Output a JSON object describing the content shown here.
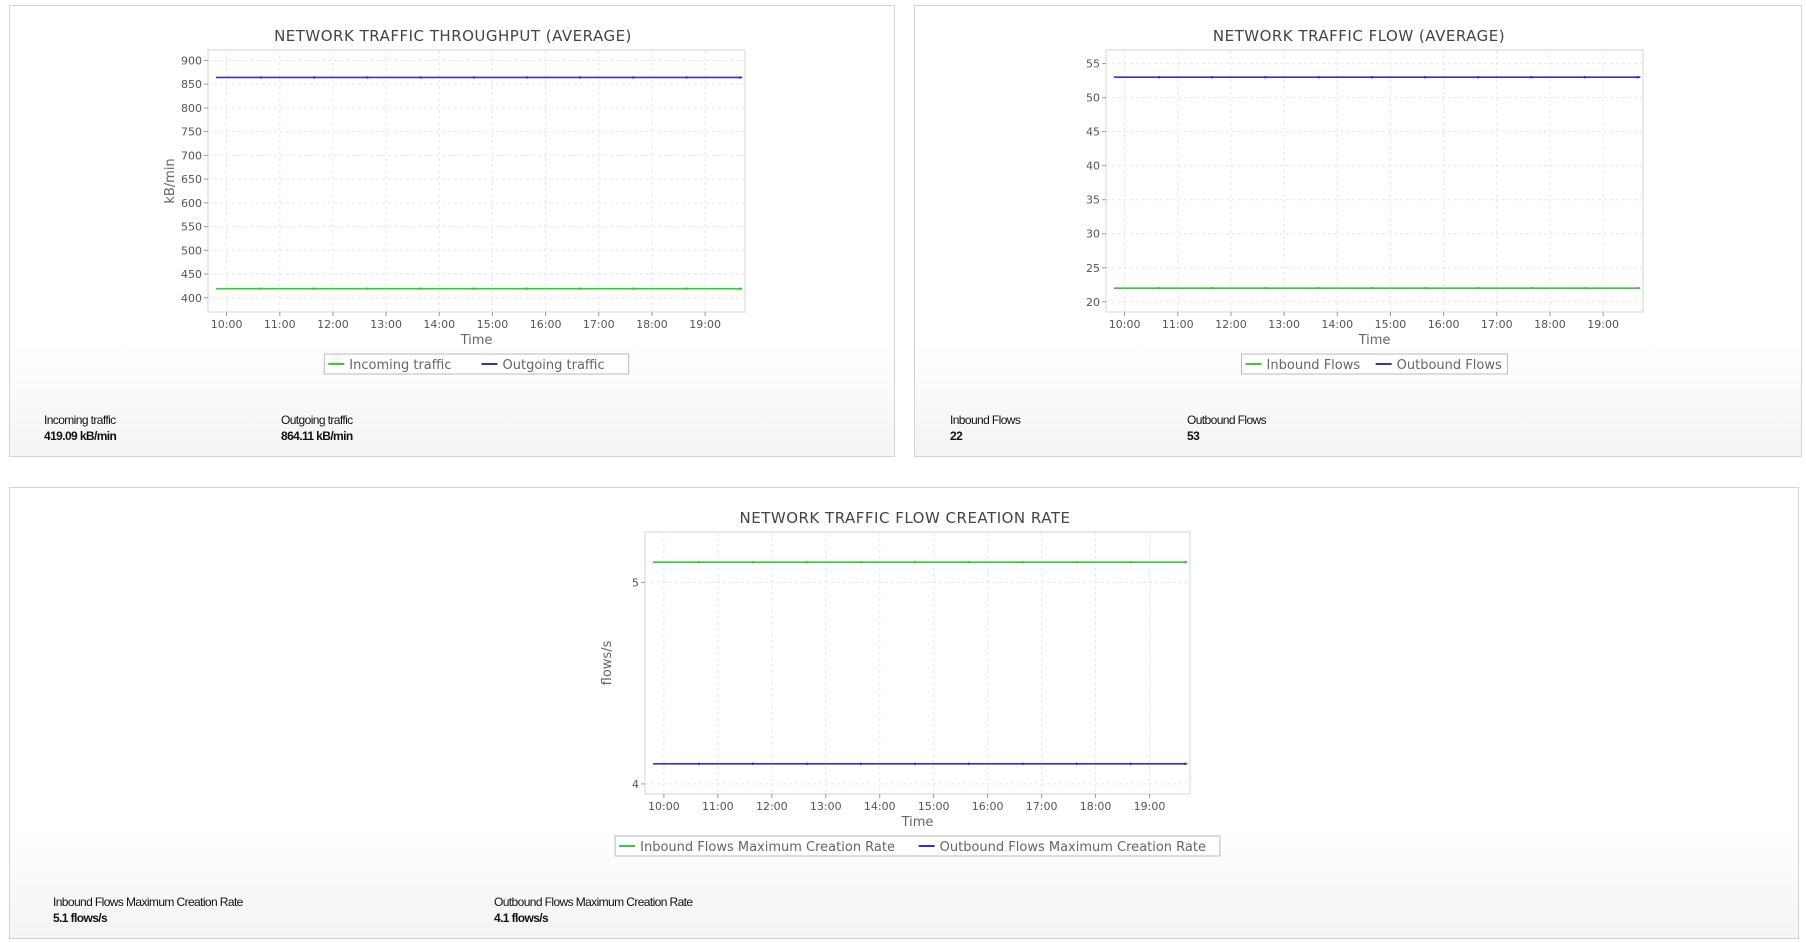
{
  "chart_data": [
    {
      "type": "line",
      "title": "NETWORK TRAFFIC THROUGHPUT (AVERAGE)",
      "xlabel": "Time",
      "ylabel": "kB/min",
      "x": [
        "10:00",
        "11:00",
        "12:00",
        "13:00",
        "14:00",
        "15:00",
        "16:00",
        "17:00",
        "18:00",
        "19:00"
      ],
      "x_range": [
        9.65,
        19.75
      ],
      "ylim": [
        370,
        922
      ],
      "yticks": [
        400,
        450,
        500,
        550,
        600,
        650,
        700,
        750,
        800,
        850,
        900
      ],
      "grid": true,
      "legend_position": "bottom-center",
      "series": [
        {
          "name": "Incoming traffic",
          "color": "#33cc33",
          "points": [
            [
              9.8,
              419.09
            ],
            [
              19.7,
              419.09
            ]
          ]
        },
        {
          "name": "Outgoing traffic",
          "color": "#3333cc",
          "points": [
            [
              9.8,
              864.11
            ],
            [
              19.7,
              864.11
            ]
          ]
        }
      ]
    },
    {
      "type": "line",
      "title": "NETWORK TRAFFIC FLOW (AVERAGE)",
      "xlabel": "Time",
      "ylabel": "",
      "x": [
        "10:00",
        "11:00",
        "12:00",
        "13:00",
        "14:00",
        "15:00",
        "16:00",
        "17:00",
        "18:00",
        "19:00"
      ],
      "x_range": [
        9.65,
        19.75
      ],
      "ylim": [
        18.5,
        57
      ],
      "yticks": [
        20,
        25,
        30,
        35,
        40,
        45,
        50,
        55
      ],
      "grid": true,
      "legend_position": "bottom-center",
      "series": [
        {
          "name": "Inbound Flows",
          "color": "#33cc33",
          "points": [
            [
              9.8,
              22
            ],
            [
              19.7,
              22
            ]
          ]
        },
        {
          "name": "Outbound Flows",
          "color": "#3333cc",
          "points": [
            [
              9.8,
              53
            ],
            [
              19.7,
              53
            ]
          ]
        }
      ]
    },
    {
      "type": "line",
      "title": "NETWORK TRAFFIC FLOW CREATION RATE",
      "xlabel": "Time",
      "ylabel": "flows/s",
      "x": [
        "10:00",
        "11:00",
        "12:00",
        "13:00",
        "14:00",
        "15:00",
        "16:00",
        "17:00",
        "18:00",
        "19:00"
      ],
      "x_range": [
        9.65,
        19.75
      ],
      "ylim": [
        3.95,
        5.25
      ],
      "yticks": [
        4,
        5
      ],
      "grid": true,
      "legend_position": "bottom-center",
      "series": [
        {
          "name": "Inbound Flows Maximum Creation Rate",
          "color": "#33cc33",
          "points": [
            [
              9.8,
              5.1
            ],
            [
              19.7,
              5.1
            ]
          ]
        },
        {
          "name": "Outbound Flows Maximum Creation Rate",
          "color": "#3333cc",
          "points": [
            [
              9.8,
              4.1
            ],
            [
              19.7,
              4.1
            ]
          ]
        }
      ]
    }
  ],
  "stats": [
    {
      "name": "Incoming traffic",
      "value": "419.09 kB/min"
    },
    {
      "name": "Outgoing traffic",
      "value": "864.11 kB/min"
    },
    {
      "name": "Inbound Flows",
      "value": "22"
    },
    {
      "name": "Outbound Flows",
      "value": "53"
    },
    {
      "name": "Inbound Flows Maximum Creation Rate",
      "value": "5.1 flows/s"
    },
    {
      "name": "Outbound Flows Maximum Creation Rate",
      "value": "4.1 flows/s"
    }
  ]
}
